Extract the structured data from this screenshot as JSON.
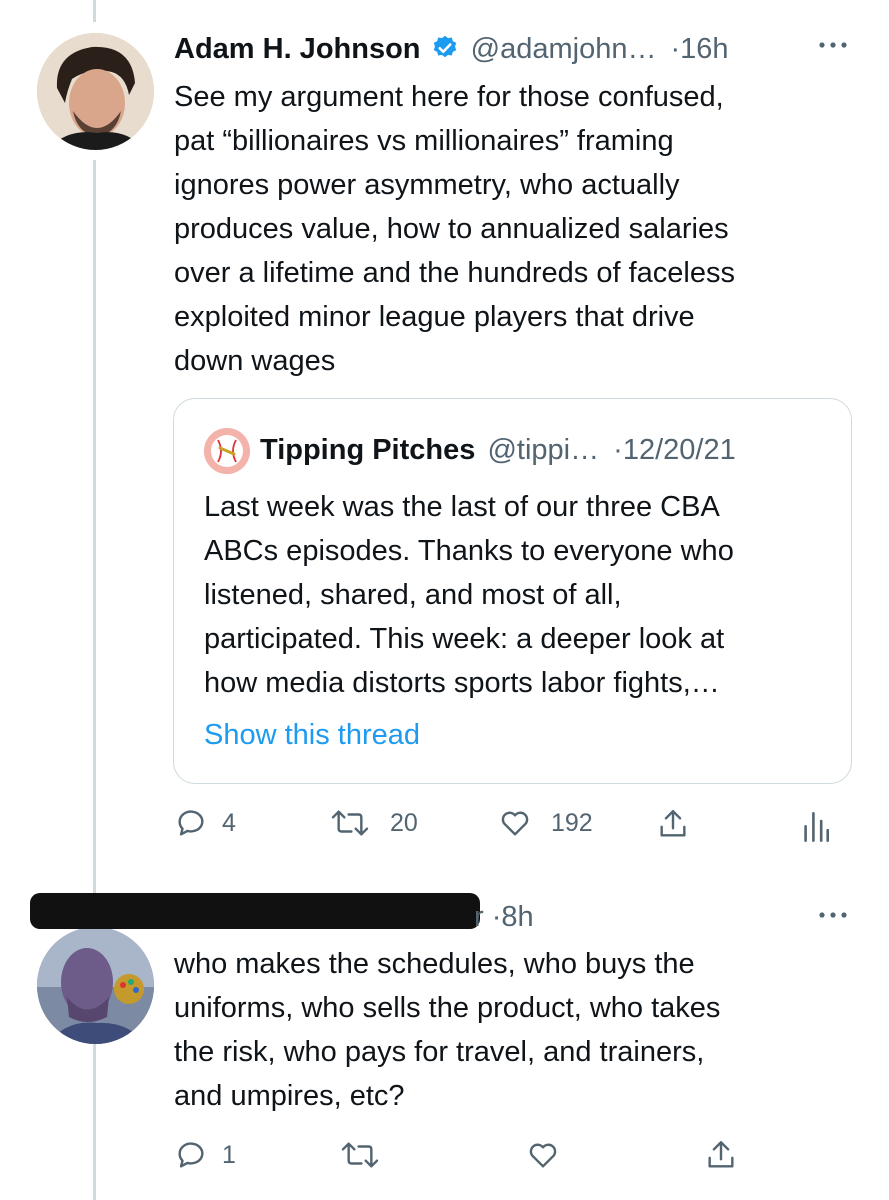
{
  "tweet1": {
    "name": "Adam H. Johnson",
    "handle": "@adamjohn…",
    "time": "·16h",
    "text_lines": [
      "See my argument here for those confused,",
      "pat “billionaires vs millionaires” framing",
      "ignores power asymmetry, who actually",
      "produces value, how to annualized salaries",
      "over a lifetime and the hundreds of faceless",
      "exploited minor league players that drive",
      "down wages"
    ],
    "quote": {
      "name": "Tipping Pitches",
      "handle": "@tippi…",
      "time": "·12/20/21",
      "text_lines": [
        "Last week was the last of our three CBA",
        "ABCs episodes. Thanks to everyone who",
        "listened, shared, and most of all,",
        "participated. This week: a deeper look at",
        "how media distorts sports labor fights,…"
      ],
      "show_thread": "Show this thread"
    },
    "actions": {
      "replies": "4",
      "retweets": "20",
      "likes": "192"
    }
  },
  "tweet2": {
    "handle_tail": "r",
    "time": "·8h",
    "text_lines": [
      "who makes the schedules, who buys the",
      "uniforms, who sells the product, who takes",
      "the risk, who pays for travel, and trainers,",
      "and umpires, etc?"
    ],
    "actions": {
      "replies": "1"
    }
  },
  "colors": {
    "text": "#0f1419",
    "muted": "#536471",
    "link": "#1d9bf0",
    "verified": "#1d9bf0",
    "border": "#cfd9de"
  }
}
